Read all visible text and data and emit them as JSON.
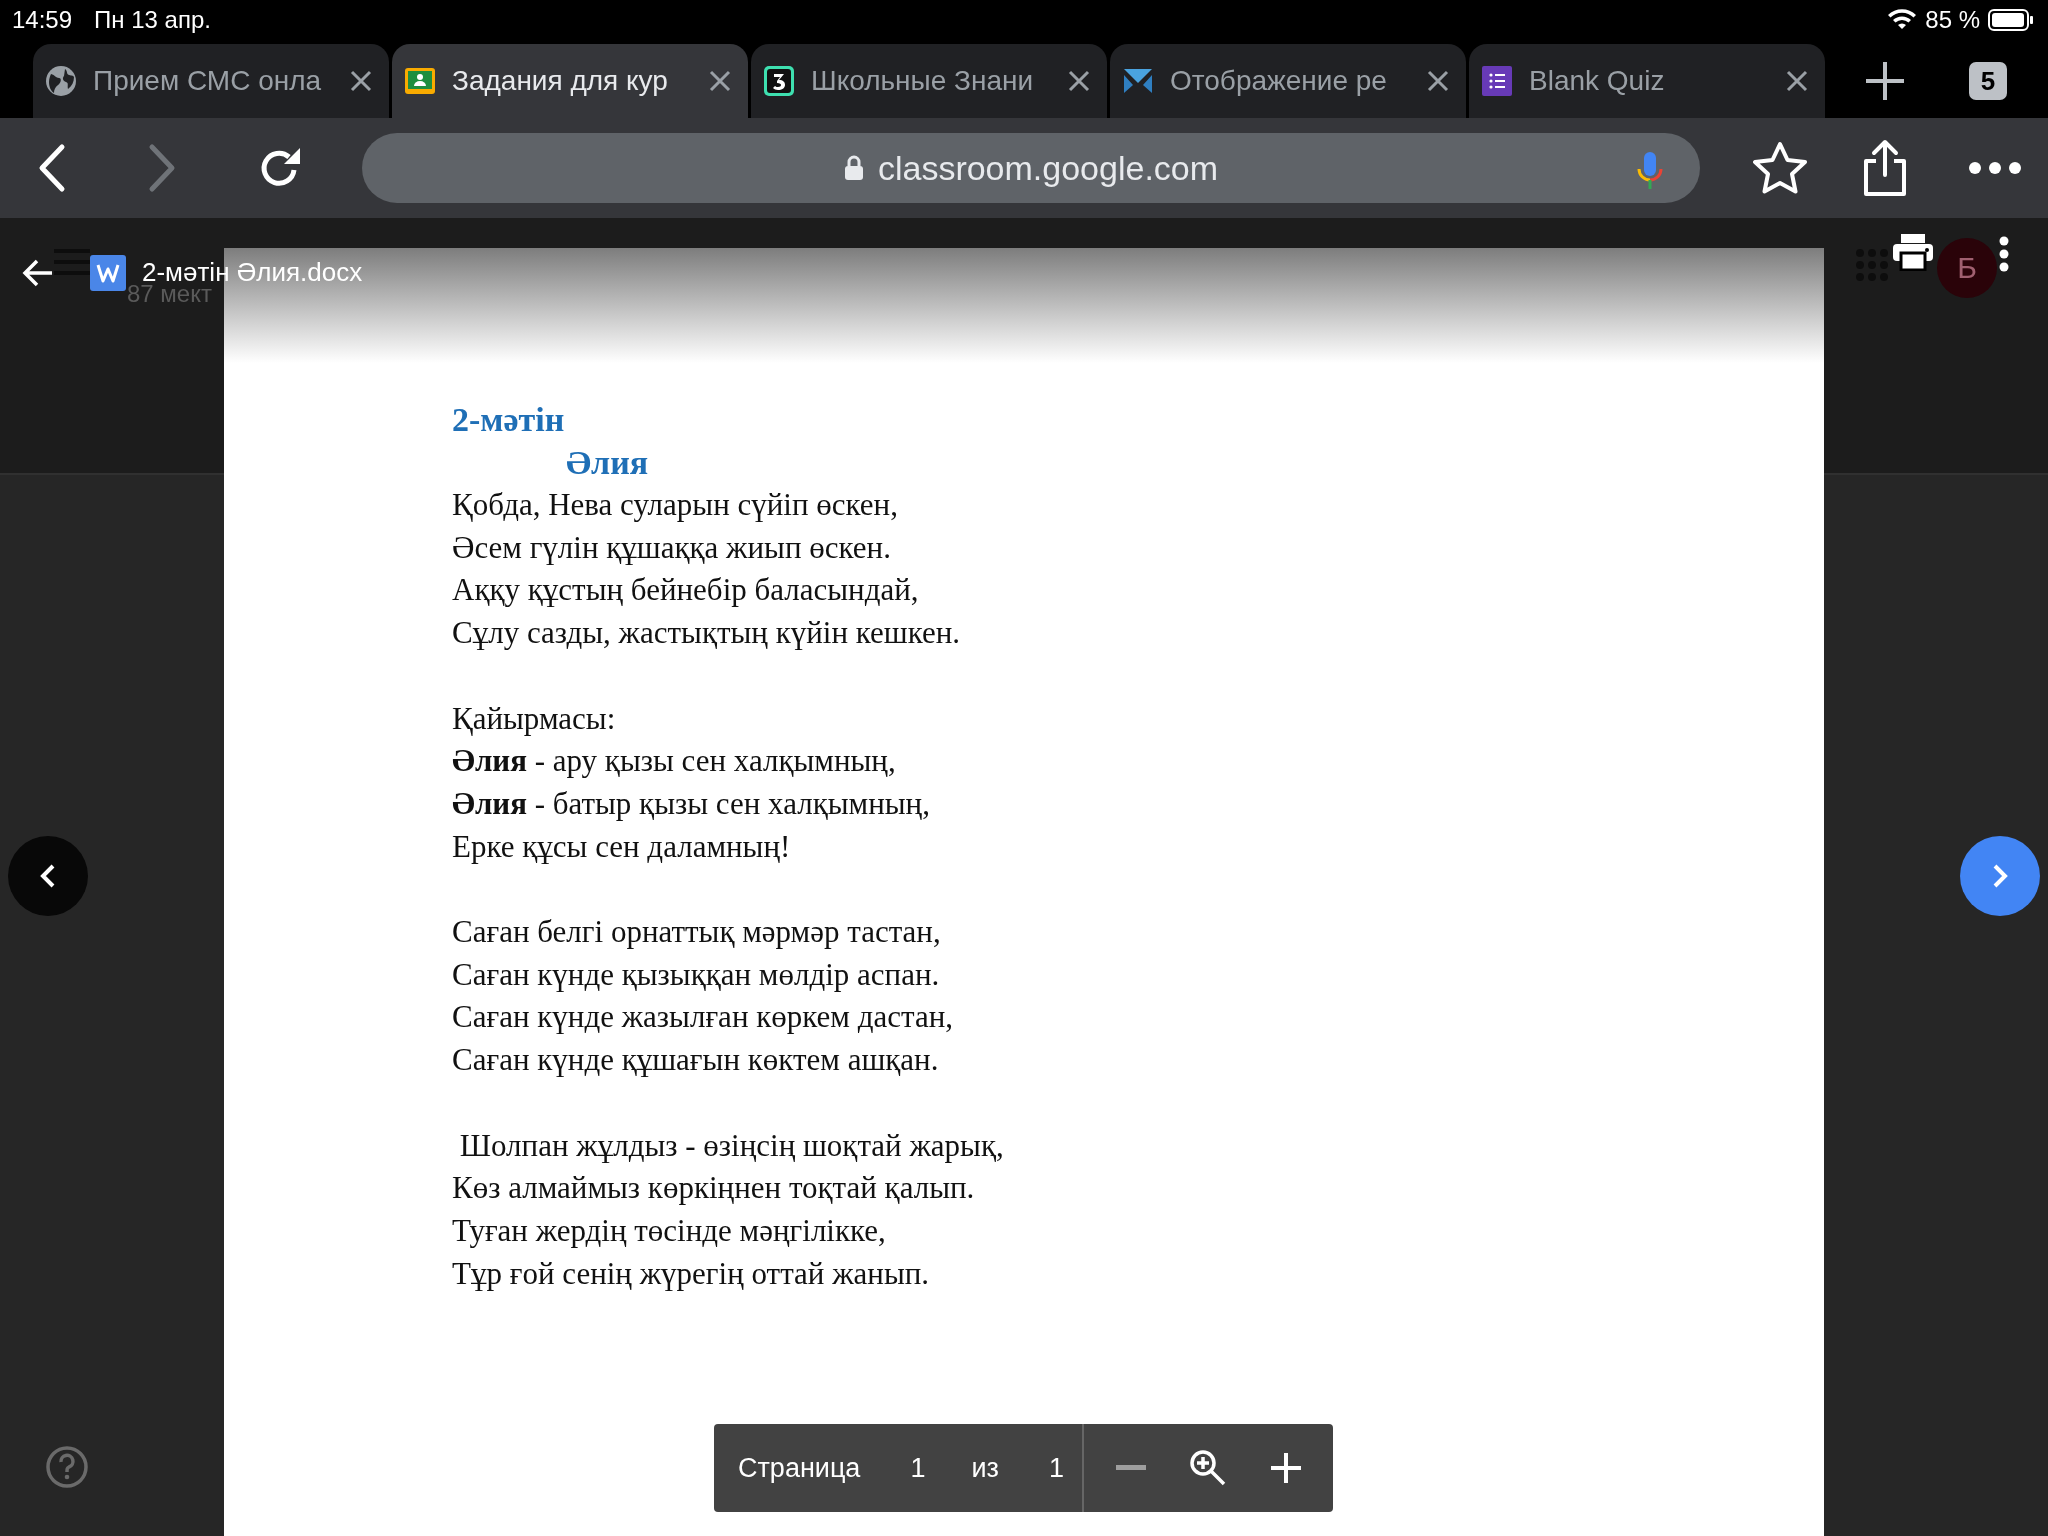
{
  "status_bar": {
    "time": "14:59",
    "date": "Пн 13 апр.",
    "battery": "85 %"
  },
  "tabs": [
    {
      "title": "Прием СМС онла",
      "selected": false,
      "kind": "globe"
    },
    {
      "title": "Задания для кур",
      "selected": true,
      "kind": "classroom"
    },
    {
      "title": "Школьные Знани",
      "selected": false,
      "kind": "digit"
    },
    {
      "title": "Отображение ре",
      "selected": false,
      "kind": "bowtie"
    },
    {
      "title": "Blank Quiz",
      "selected": false,
      "kind": "form"
    }
  ],
  "tab_count": "5",
  "toolbar": {
    "forward_disabled": true,
    "url": "classroom.google.com"
  },
  "background_page": {
    "subtitle": "87 мект",
    "avatar": "Б"
  },
  "viewer": {
    "file_name": "2-мәтін Әлия.docx"
  },
  "document": {
    "heading": "2-мәтін",
    "title": "Әлия",
    "stanzas": [
      [
        "Қобда, Нева суларын сүйіп өскен,",
        "Әсем гүлін құшаққа жиып өскен.",
        "Аққу құстың бейнебір баласындай,",
        "Сұлу сазды, жастықтың күйін кешкен."
      ],
      [
        "Қайырмасы:",
        "**Әлия** - ару қызы сен халқымның,",
        "**Әлия** - батыр қызы сен халқымның,",
        "Ерке құсы сен даламның!"
      ],
      [
        "Саған белгі орнаттық мәрмәр тастан,",
        "Саған күнде қызыққан мөлдір аспан.",
        "Саған күнде жазылған көркем дастан,",
        "Саған күнде құшағын көктем ашқан."
      ],
      [
        " Шолпан жұлдыз - өзіңсің шоқтай жарық,",
        "Көз алмаймыз көркіңнен тоқтай қалып.",
        "Туған жердің төсінде мәңгілікке,",
        "Тұр ғой сенің жүрегің оттай жанып."
      ]
    ]
  },
  "pager": {
    "label": "Страница",
    "current": "1",
    "of": "из",
    "total": "1"
  }
}
